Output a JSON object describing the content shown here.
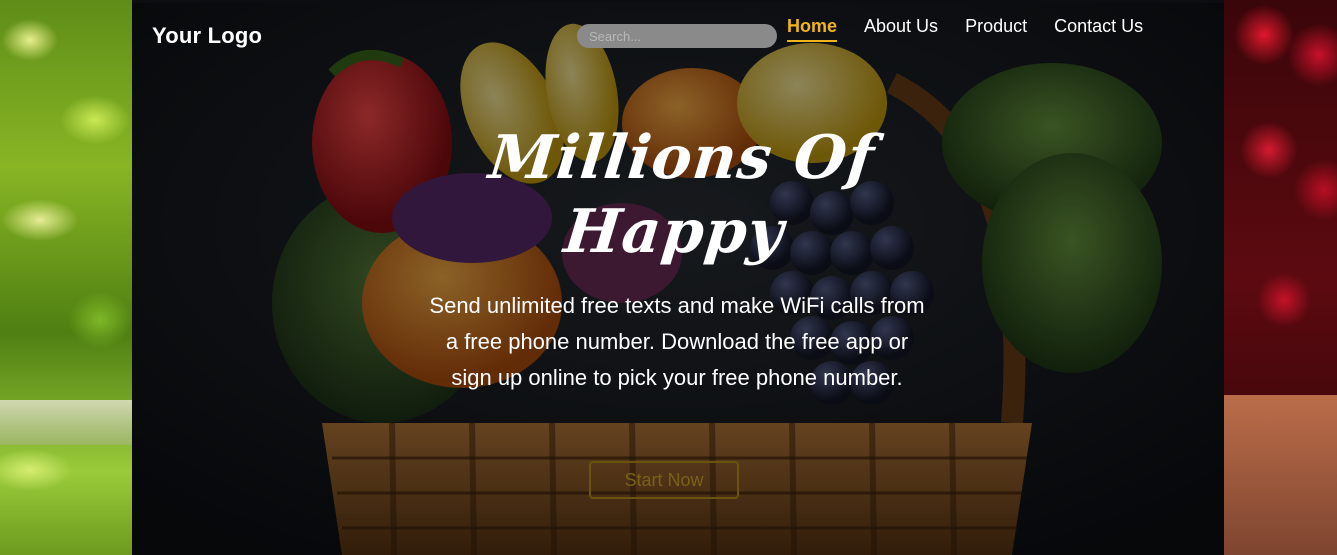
{
  "header": {
    "logo_text": "Your Logo",
    "search_placeholder": "Search...",
    "nav": [
      {
        "label": "Home",
        "active": true
      },
      {
        "label": "About Us",
        "active": false
      },
      {
        "label": "Product",
        "active": false
      },
      {
        "label": "Contact Us",
        "active": false
      }
    ]
  },
  "hero": {
    "headline_line1": "Millions Of",
    "headline_line2": "Happy",
    "tagline": "Send unlimited free texts and make WiFi calls from a free phone number. Download the free app or sign up online to pick your free phone number.",
    "cta_label": "Start Now"
  },
  "colors": {
    "accent": "#f0b41c",
    "cta_border": "#6b5410",
    "text": "#ffffff"
  }
}
